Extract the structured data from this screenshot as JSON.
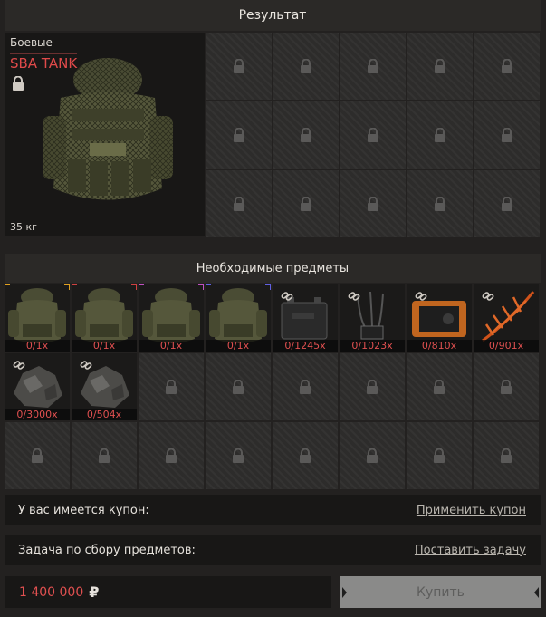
{
  "header": {
    "title": "Результат"
  },
  "result": {
    "category": "Боевые",
    "name": "SBA TANK",
    "weight": "35 кг",
    "icon": "lock-icon"
  },
  "required": {
    "title": "Необходимые предметы",
    "items": [
      {
        "count": "0/1x",
        "kind": "armor",
        "corner": "#e0a020"
      },
      {
        "count": "0/1x",
        "kind": "armor",
        "corner": "#d04040"
      },
      {
        "count": "0/1x",
        "kind": "armor",
        "corner": "#c050c0"
      },
      {
        "count": "0/1x",
        "kind": "armor",
        "corner": "#6060e0"
      },
      {
        "count": "0/1245x",
        "kind": "battery"
      },
      {
        "count": "0/1023x",
        "kind": "wires"
      },
      {
        "count": "0/810x",
        "kind": "device"
      },
      {
        "count": "0/901x",
        "kind": "fern"
      },
      {
        "count": "0/3000x",
        "kind": "ore"
      },
      {
        "count": "0/504x",
        "kind": "ore"
      }
    ]
  },
  "coupon": {
    "label": "У вас имеется купон:",
    "action": "Применить купон"
  },
  "task": {
    "label": "Задача по сбору предметов:",
    "action": "Поставить задачу"
  },
  "price": {
    "amount": "1 400 000",
    "currency": "₽"
  },
  "buy": {
    "label": "Купить"
  },
  "colors": {
    "accent_red": "#e05050",
    "panel": "#181716",
    "background": "#232120"
  }
}
